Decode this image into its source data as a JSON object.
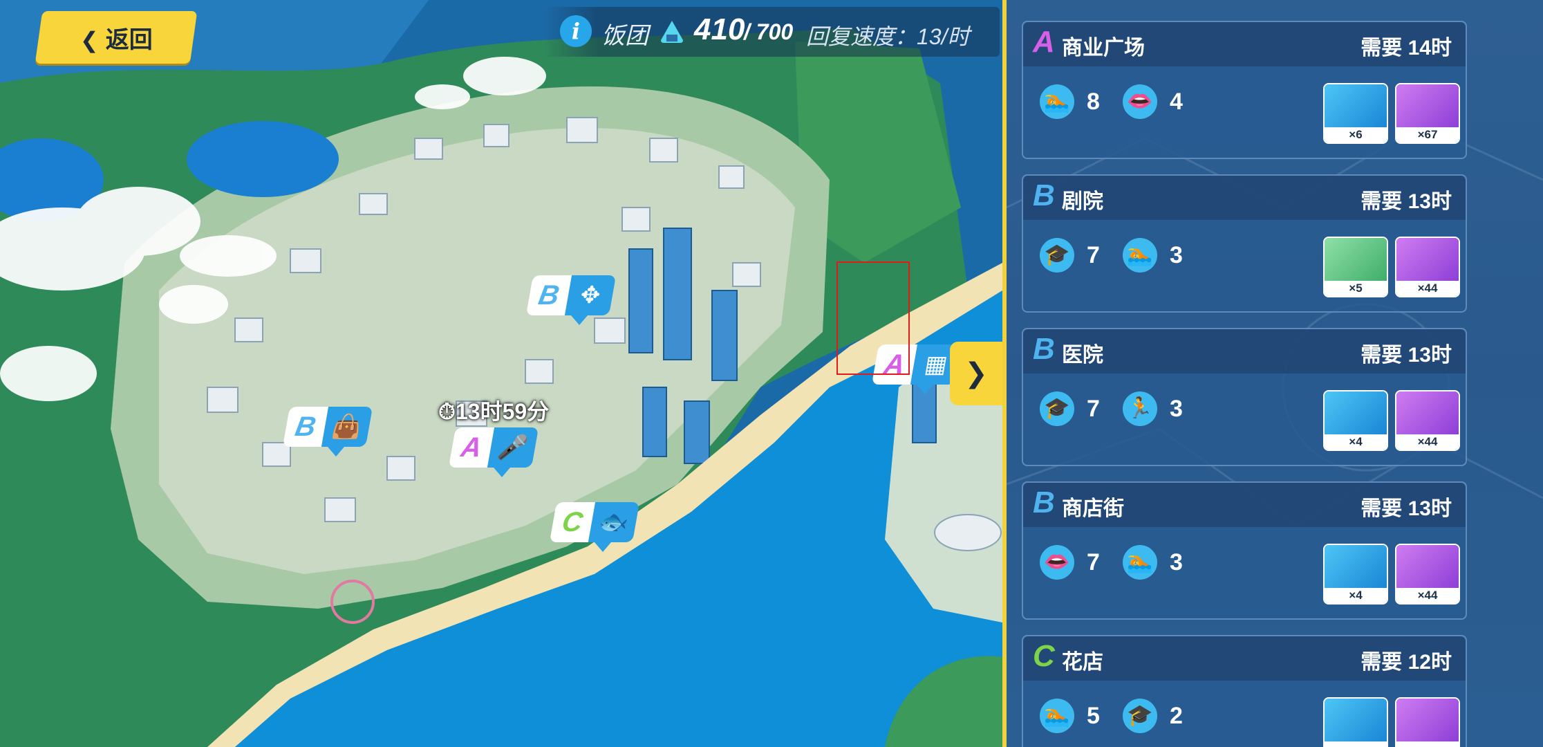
{
  "header": {
    "back_label": "返回",
    "resource_name": "饭团",
    "resource_current": "410",
    "resource_max": "/ 700",
    "recovery_rate": "回复速度：13/时"
  },
  "map": {
    "timer": "13时59分",
    "markers": [
      {
        "grade": "B",
        "icon": "move-icon",
        "glyph": "✥"
      },
      {
        "grade": "B",
        "icon": "bag-icon",
        "glyph": "👜"
      },
      {
        "grade": "A",
        "icon": "microphone-icon",
        "glyph": "🎤"
      },
      {
        "grade": "C",
        "icon": "fish-icon",
        "glyph": "🐟"
      },
      {
        "grade": "A",
        "icon": "building-icon",
        "glyph": "▦"
      }
    ]
  },
  "locations": [
    {
      "grade": "A",
      "name": "商业广场",
      "need": "需要 14时",
      "reqs": [
        {
          "icon": "swim-icon",
          "glyph": "🏊",
          "value": "8"
        },
        {
          "icon": "lips-icon",
          "glyph": "👄",
          "value": "4"
        }
      ],
      "rewards": [
        {
          "type": "chip",
          "color": "blue",
          "count": "×6"
        },
        {
          "type": "ticket",
          "color": "purple",
          "count": "×67"
        }
      ]
    },
    {
      "grade": "B",
      "name": "剧院",
      "need": "需要 13时",
      "reqs": [
        {
          "icon": "graduation-cap-icon",
          "glyph": "🎓",
          "value": "7"
        },
        {
          "icon": "swim-icon",
          "glyph": "🏊",
          "value": "3"
        }
      ],
      "rewards": [
        {
          "type": "gem",
          "color": "green",
          "count": "×5"
        },
        {
          "type": "ticket",
          "color": "purple",
          "count": "×44"
        }
      ]
    },
    {
      "grade": "B",
      "name": "医院",
      "need": "需要 13时",
      "reqs": [
        {
          "icon": "graduation-cap-icon",
          "glyph": "🎓",
          "value": "7"
        },
        {
          "icon": "runner-icon",
          "glyph": "🏃",
          "value": "3"
        }
      ],
      "rewards": [
        {
          "type": "chip",
          "color": "blue",
          "count": "×4"
        },
        {
          "type": "ticket",
          "color": "purple",
          "count": "×44"
        }
      ]
    },
    {
      "grade": "B",
      "name": "商店街",
      "need": "需要 13时",
      "reqs": [
        {
          "icon": "lips-icon",
          "glyph": "👄",
          "value": "7"
        },
        {
          "icon": "swim-icon",
          "glyph": "🏊",
          "value": "3"
        }
      ],
      "rewards": [
        {
          "type": "chip",
          "color": "blue",
          "count": "×4"
        },
        {
          "type": "ticket",
          "color": "purple",
          "count": "×44"
        }
      ]
    },
    {
      "grade": "C",
      "name": "花店",
      "need": "需要 12时",
      "reqs": [
        {
          "icon": "swim-icon",
          "glyph": "🏊",
          "value": "5"
        },
        {
          "icon": "graduation-cap-icon",
          "glyph": "🎓",
          "value": "2"
        }
      ],
      "rewards": [
        {
          "type": "chip",
          "color": "blue",
          "count": ""
        },
        {
          "type": "ticket",
          "color": "purple",
          "count": ""
        }
      ]
    }
  ],
  "colors": {
    "accent_yellow": "#f7d53b",
    "grade_A": "#d85fe8",
    "grade_B": "#4fb3f0",
    "grade_C": "#7dd34a"
  }
}
